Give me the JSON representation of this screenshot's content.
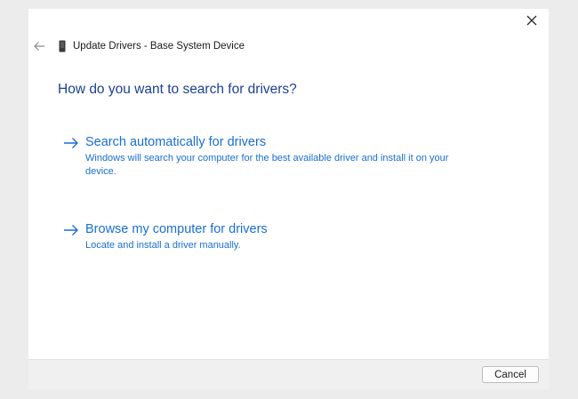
{
  "window": {
    "title": "Update Drivers - Base System Device"
  },
  "icons": {
    "back": "back-arrow-icon",
    "device": "device-icon",
    "close": "close-icon",
    "option_arrow": "right-arrow-icon"
  },
  "main": {
    "heading": "How do you want to search for drivers?",
    "options": [
      {
        "title": "Search automatically for drivers",
        "description": "Windows will search your computer for the best available driver and install it on your device."
      },
      {
        "title": "Browse my computer for drivers",
        "description": "Locate and install a driver manually."
      }
    ]
  },
  "footer": {
    "cancel_label": "Cancel"
  },
  "colors": {
    "heading": "#1c3f94",
    "link": "#1a6fd0",
    "background": "#ececec",
    "dialog": "#ffffff",
    "footer": "#f0f0f0"
  }
}
